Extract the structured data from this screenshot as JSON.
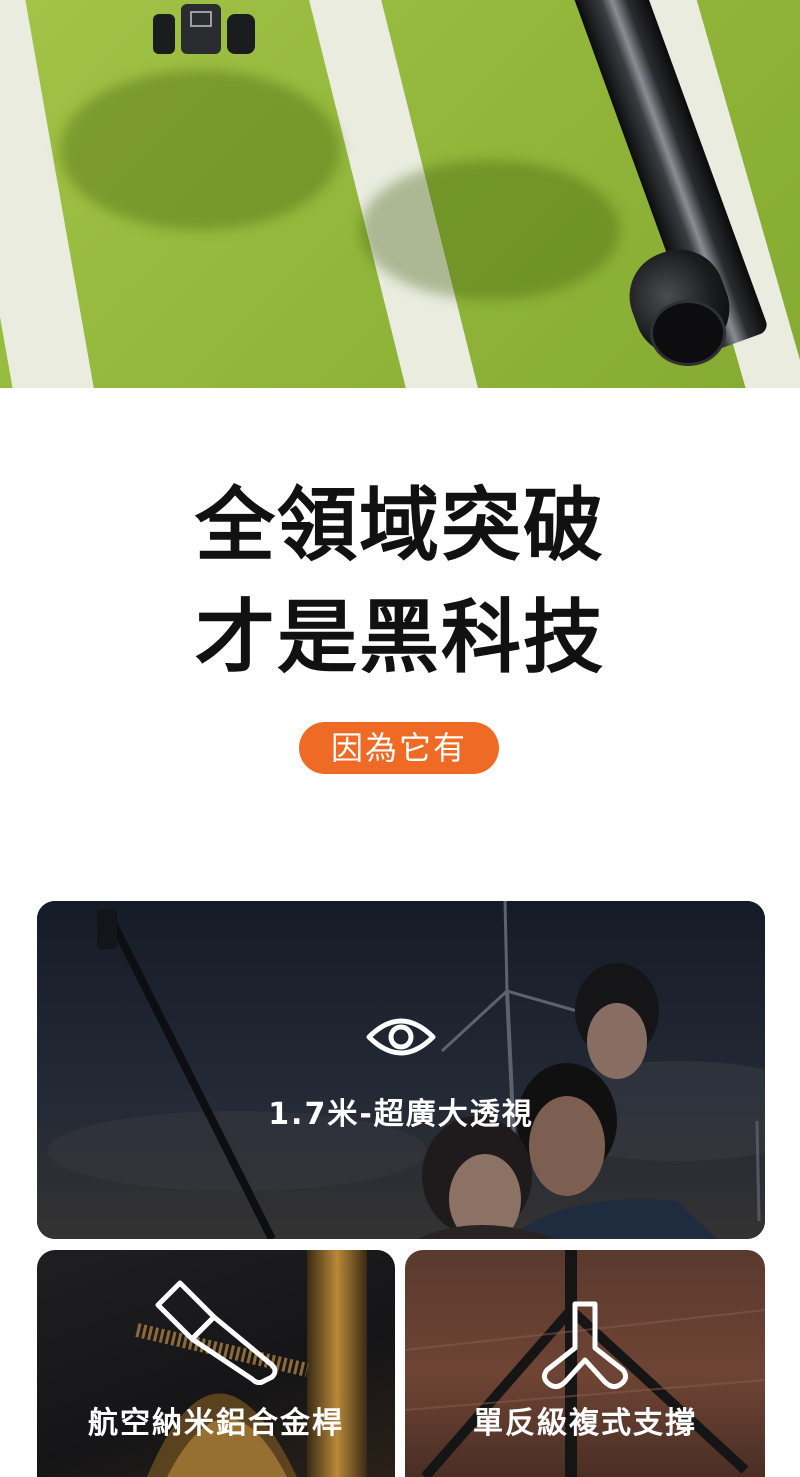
{
  "hero": {
    "image_description_icon": "tripod-pole-on-green-track"
  },
  "headline": {
    "line1": "全領域突破",
    "line2": "才是黑科技"
  },
  "tag": {
    "label": "因為它有"
  },
  "features": [
    {
      "title": "1.7米-超廣大透視",
      "icon": "eye-icon"
    },
    {
      "title": "航空納米鋁合金桿",
      "icon": "tube-icon"
    },
    {
      "title": "單反級複式支撐",
      "icon": "tripod-icon"
    }
  ],
  "colors": {
    "accent": "#ef6a24",
    "hero_green": "#93b83c",
    "text": "#111111"
  }
}
